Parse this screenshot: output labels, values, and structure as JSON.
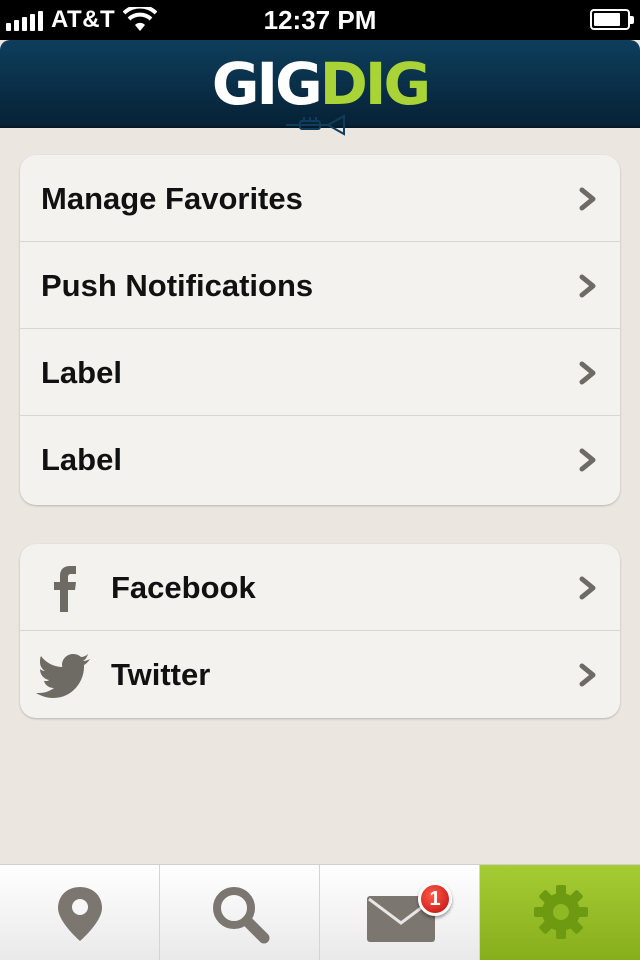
{
  "status_bar": {
    "carrier": "AT&T",
    "time": "12:37 PM",
    "signal_icon": "signal-bars-icon",
    "wifi_icon": "wifi-icon",
    "battery_icon": "battery-icon"
  },
  "header": {
    "logo_part1": "GIG",
    "logo_part2": "DIG",
    "logo_icon": "trumpet-icon",
    "colors": {
      "background": "#0b3450",
      "logo_white": "#ffffff",
      "logo_green": "#a9d337"
    }
  },
  "settings_list": {
    "items": [
      {
        "label": "Manage Favorites",
        "icon": "chevron-right-icon"
      },
      {
        "label": "Push Notifications",
        "icon": "chevron-right-icon"
      },
      {
        "label": "Label",
        "icon": "chevron-right-icon"
      },
      {
        "label": "Label",
        "icon": "chevron-right-icon"
      }
    ]
  },
  "social_list": {
    "items": [
      {
        "label": "Facebook",
        "icon": "facebook-icon"
      },
      {
        "label": "Twitter",
        "icon": "twitter-icon"
      }
    ]
  },
  "tab_bar": {
    "tabs": [
      {
        "icon": "map-pin-icon",
        "active": false
      },
      {
        "icon": "search-icon",
        "active": false
      },
      {
        "icon": "mail-icon",
        "active": false,
        "badge": "1"
      },
      {
        "icon": "gear-icon",
        "active": true
      }
    ],
    "colors": {
      "active": "#95bd26",
      "icon_gray": "#6e6a64",
      "badge": "#d31414"
    }
  }
}
